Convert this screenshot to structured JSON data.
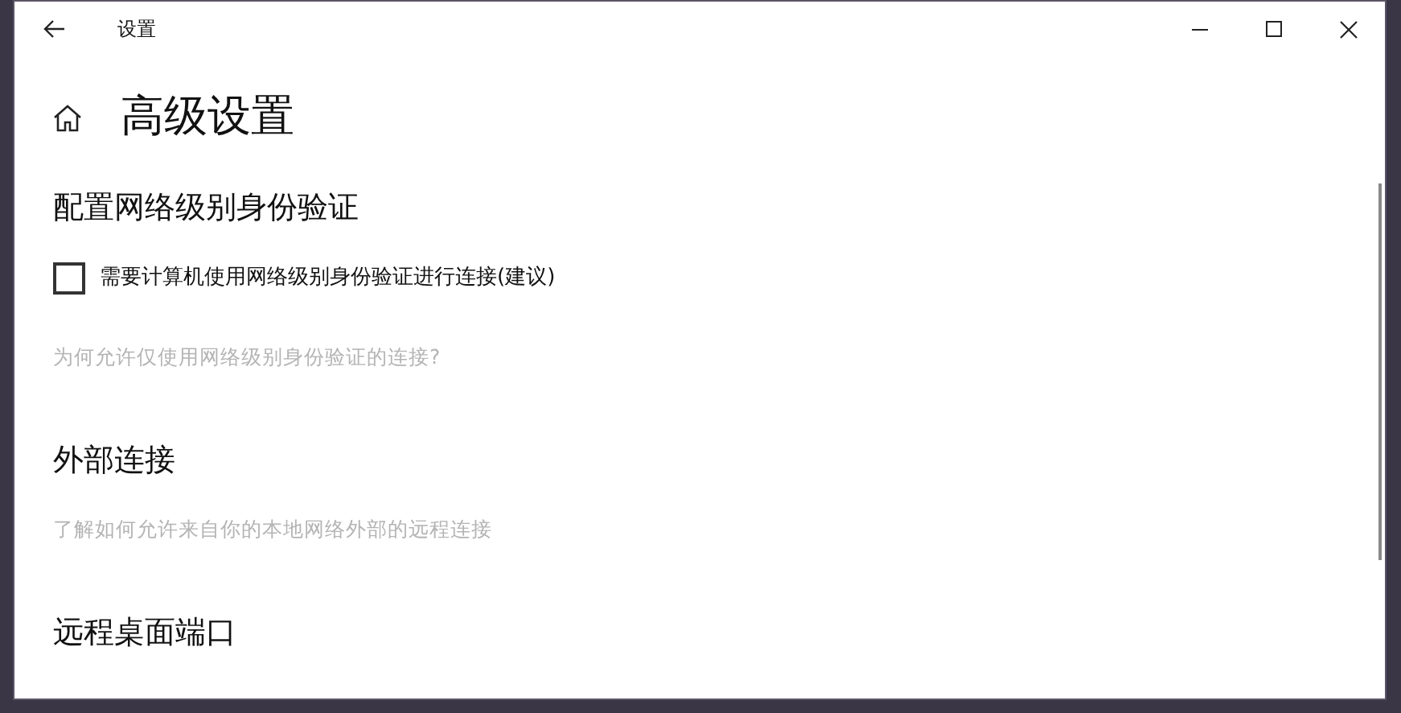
{
  "window": {
    "title": "设置"
  },
  "page": {
    "title": "高级设置"
  },
  "sections": [
    {
      "heading": "配置网络级别身份验证",
      "checkbox": {
        "label": "需要计算机使用网络级别身份验证进行连接(建议)",
        "checked": false
      },
      "link": "为何允许仅使用网络级别身份验证的连接?"
    },
    {
      "heading": "外部连接",
      "link": "了解如何允许来自你的本地网络外部的远程连接"
    },
    {
      "heading": "远程桌面端口"
    }
  ]
}
